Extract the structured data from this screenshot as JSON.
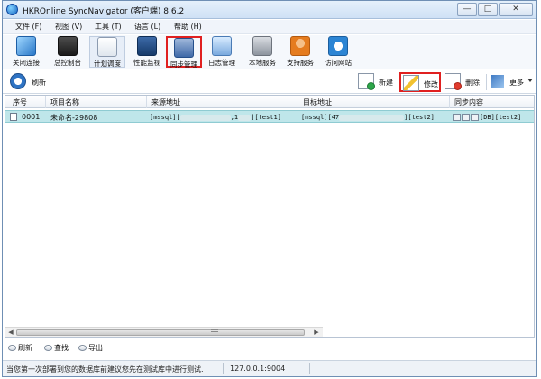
{
  "window": {
    "title": "HKROnline SyncNavigator (客户端) 8.6.2",
    "controls": {
      "minimize": "—",
      "maximize": "□",
      "close": "✕"
    }
  },
  "menu": [
    "文件 (F)",
    "视图 (V)",
    "工具 (T)",
    "语言 (L)",
    "帮助 (H)"
  ],
  "toolbar": [
    {
      "label": "关闭连接",
      "icon": "plug-icon"
    },
    {
      "label": "总控制台",
      "icon": "monitor-icon"
    },
    {
      "label": "计划调度",
      "icon": "schedule-icon"
    },
    {
      "label": "性能监视",
      "icon": "performance-icon"
    },
    {
      "label": "同步管理",
      "icon": "sync-manage-icon"
    },
    {
      "label": "日志管理",
      "icon": "log-icon"
    },
    {
      "label": "本地服务",
      "icon": "server-icon"
    },
    {
      "label": "支持服务",
      "icon": "support-person-icon"
    },
    {
      "label": "访问网站",
      "icon": "web-icon"
    }
  ],
  "actions": {
    "refresh": "刷新",
    "new": "新建",
    "edit": "修改",
    "delete": "删除",
    "more": "更多"
  },
  "table": {
    "columns": [
      "序号",
      "项目名称",
      "来源地址",
      "目标地址",
      "同步内容"
    ],
    "rows": [
      {
        "id": "0001",
        "name": "未命名-29808",
        "source_prefix": "[mssql][",
        "source_mid": ",1",
        "source_suffix": "][test1]",
        "target_prefix": "[mssql][47",
        "target_suffix": "][test2]",
        "content": "[DB][test2]"
      }
    ]
  },
  "bottom_buttons": [
    "刷新",
    "查找",
    "导出"
  ],
  "status": {
    "message": "当您第一次部署到您的数据库前建议您先在测试库中进行测试.",
    "address": "127.0.0.1:9004"
  },
  "highlight_color": "#e02020"
}
